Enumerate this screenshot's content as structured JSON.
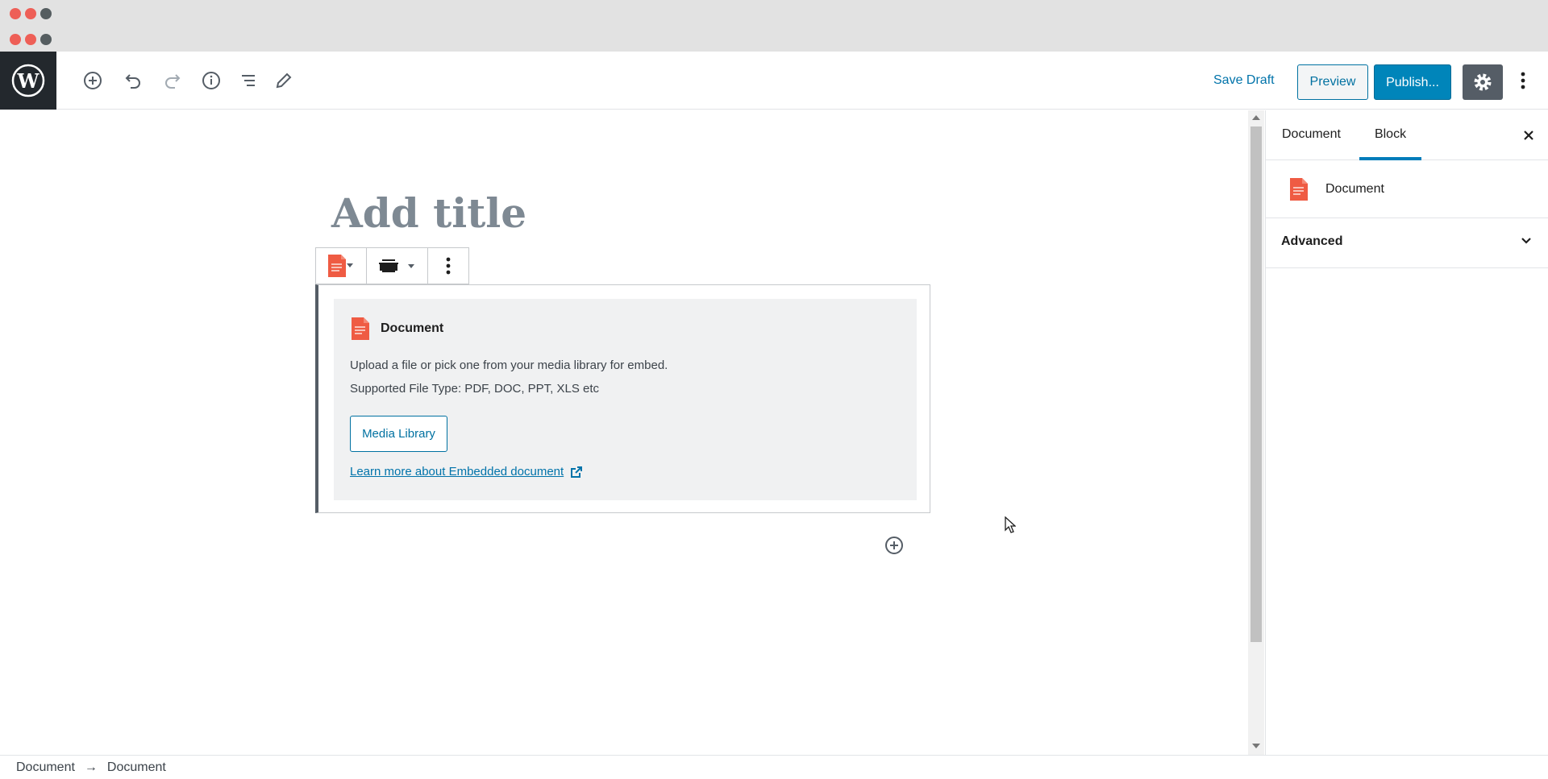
{
  "toolbar": {
    "save_draft": "Save Draft",
    "preview": "Preview",
    "publish": "Publish..."
  },
  "editor": {
    "title_placeholder": "Add title",
    "placeholder": {
      "heading": "Document",
      "line1": "Upload a file or pick one from your media library for embed.",
      "line2": "Supported File Type: PDF, DOC, PPT, XLS etc",
      "button": "Media Library",
      "link": "Learn more about Embedded document"
    }
  },
  "sidebar": {
    "tabs": [
      "Document",
      "Block"
    ],
    "active_tab": "Block",
    "block_name": "Document",
    "panel_advanced": "Advanced"
  },
  "breadcrumb": [
    "Document",
    "Document"
  ],
  "colors": {
    "accent": "#0085ba",
    "doc_icon": "#ef5b43",
    "wp_dark": "#23282d"
  }
}
